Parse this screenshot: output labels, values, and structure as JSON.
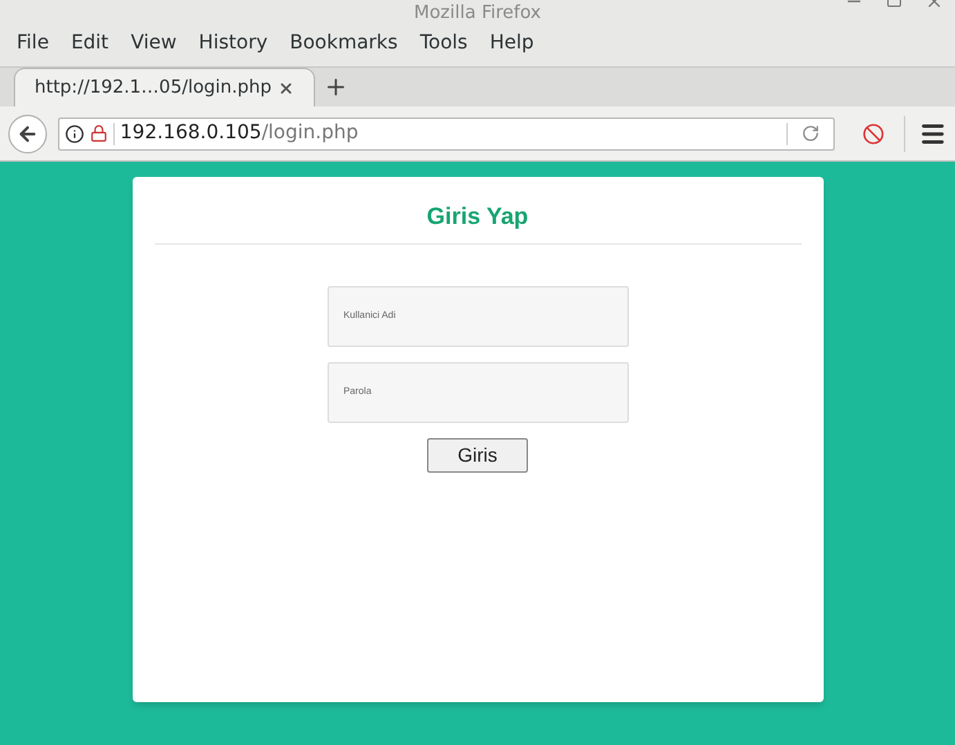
{
  "window": {
    "title": "Mozilla Firefox"
  },
  "menu": [
    "File",
    "Edit",
    "View",
    "History",
    "Bookmarks",
    "Tools",
    "Help"
  ],
  "tabs": [
    {
      "label": "http://192.1…05/login.php",
      "selected": true
    }
  ],
  "address": {
    "host": "192.168.0.105",
    "path": "/login.php"
  },
  "form": {
    "title": "Giris Yap",
    "username": {
      "placeholder": "Kullanici Adi"
    },
    "password": {
      "placeholder": "Parola"
    },
    "submit": "Giris"
  }
}
